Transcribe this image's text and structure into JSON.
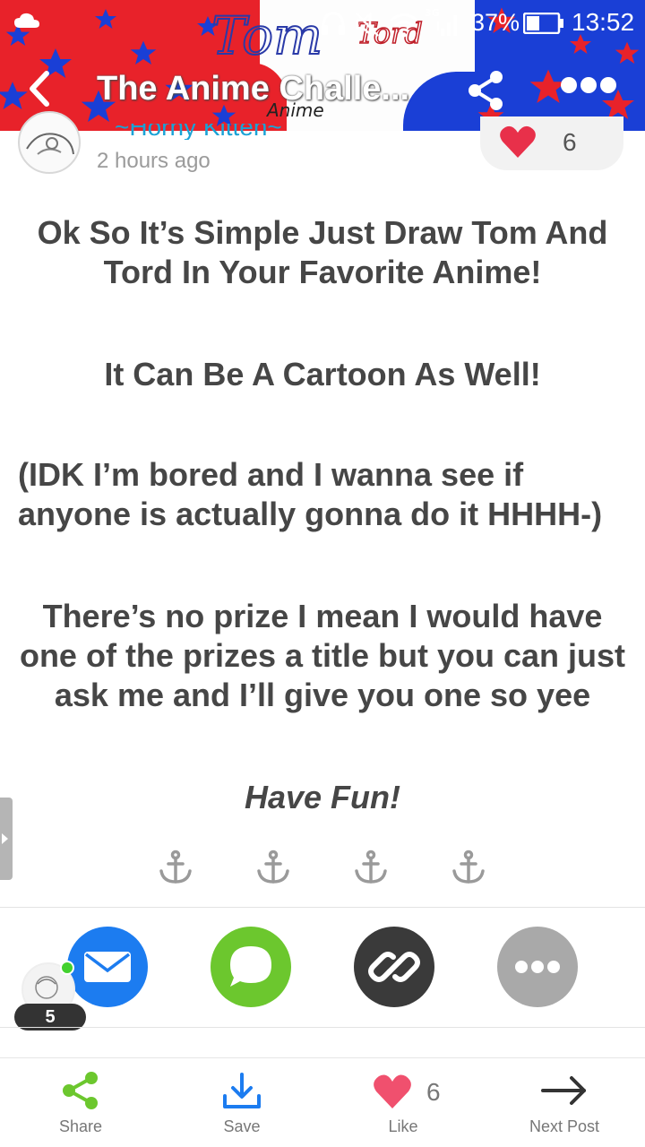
{
  "status_bar": {
    "network": "3G",
    "battery": "37%",
    "time": "13:52"
  },
  "header": {
    "title": "The Anime Challe...",
    "banner_text": [
      "Tom",
      "Tord",
      "Anime"
    ],
    "colors": {
      "red": "#e8222a",
      "blue": "#1a3fd6",
      "star": "#1a3fd6"
    }
  },
  "author": {
    "name": "~Horny Kitten~",
    "timestamp": "2 hours ago"
  },
  "likes": {
    "count": "6"
  },
  "post": {
    "paragraphs": [
      "Ok So It’s Simple Just Draw Tom And Tord In Your Favorite Anime!",
      "It Can Be A Cartoon As Well!",
      "(IDK I’m bored and I wanna see if anyone is actually gonna do it HHHH-)",
      "There’s no prize I mean I would have one of the prizes a title but you can just ask me and I’ll give you one so yee",
      "Have Fun!"
    ],
    "divider_icons": [
      "anchor-icon",
      "anchor-icon",
      "anchor-icon",
      "anchor-icon"
    ]
  },
  "share_row": {
    "options": [
      "email-icon",
      "chat-icon",
      "link-icon",
      "more-icon"
    ],
    "colors": {
      "email": "#1c7cf0",
      "chat": "#6cc72e",
      "link": "#3a3a3a",
      "more": "#a9a9a9"
    }
  },
  "online": {
    "count": "5"
  },
  "bottom_bar": {
    "share_label": "Share",
    "save_label": "Save",
    "like_label": "Like",
    "like_count": "6",
    "next_label": "Next Post",
    "colors": {
      "share": "#6cc72e",
      "save": "#1c7cf0",
      "like": "#f0506e"
    }
  }
}
